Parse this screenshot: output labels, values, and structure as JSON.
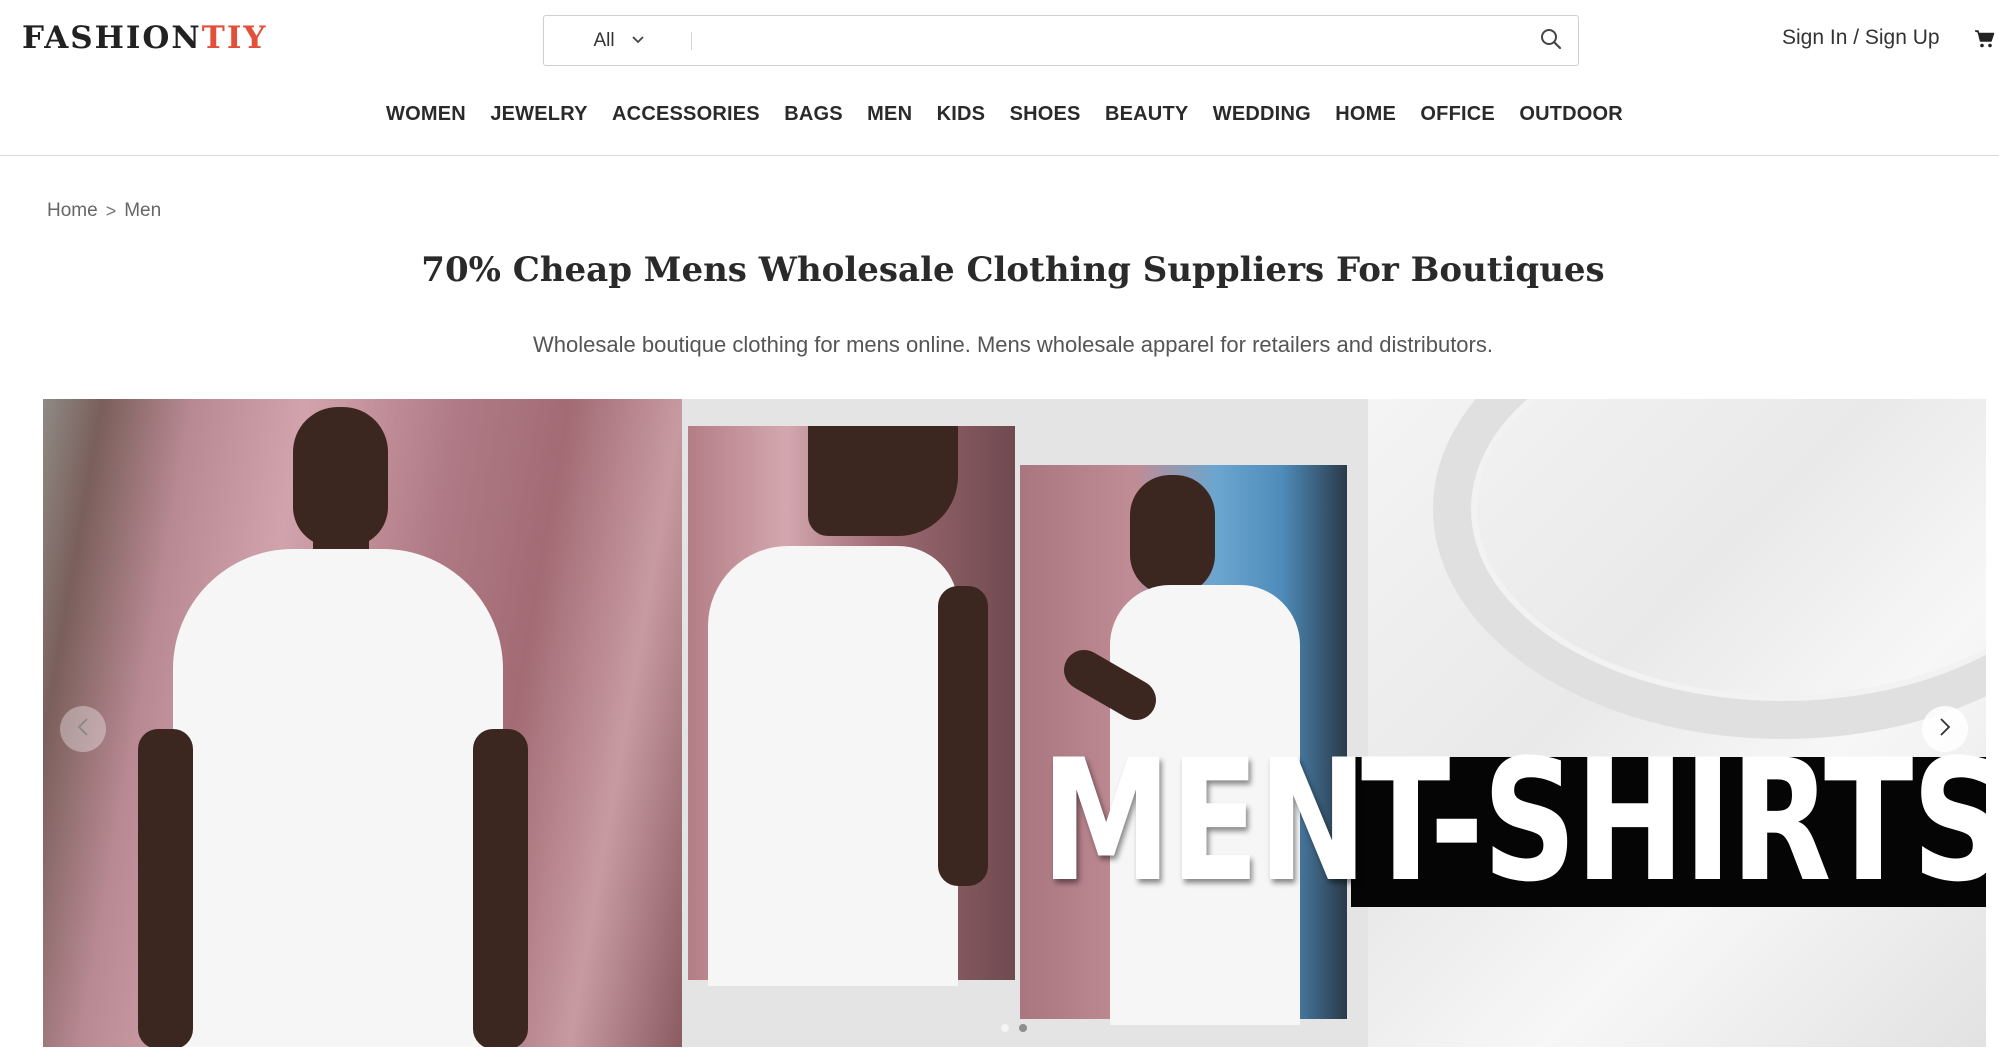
{
  "header": {
    "logo_main": "FASHION",
    "logo_accent": "TIY",
    "brand_color": "#e2503a",
    "search": {
      "category": "All",
      "placeholder": "",
      "value": "",
      "icon": "search-icon"
    },
    "account": "Sign In / Sign Up",
    "cart_icon": "cart-icon"
  },
  "nav": {
    "items": [
      "WOMEN",
      "JEWELRY",
      "ACCESSORIES",
      "BAGS",
      "MEN",
      "KIDS",
      "SHOES",
      "BEAUTY",
      "WEDDING",
      "HOME",
      "OFFICE",
      "OUTDOOR"
    ]
  },
  "breadcrumb": {
    "home": "Home",
    "separator": ">",
    "current": "Men"
  },
  "page": {
    "title": "70% Cheap Mens Wholesale Clothing Suppliers For Boutiques",
    "subtitle": "Wholesale boutique clothing for mens online. Mens wholesale apparel for retailers and distributors."
  },
  "banner": {
    "text_left": "MEN",
    "text_right": "T-SHIRTS",
    "prev_icon": "chevron-left-icon",
    "next_icon": "chevron-right-icon",
    "slide_count": 2,
    "active_slide": 2
  }
}
